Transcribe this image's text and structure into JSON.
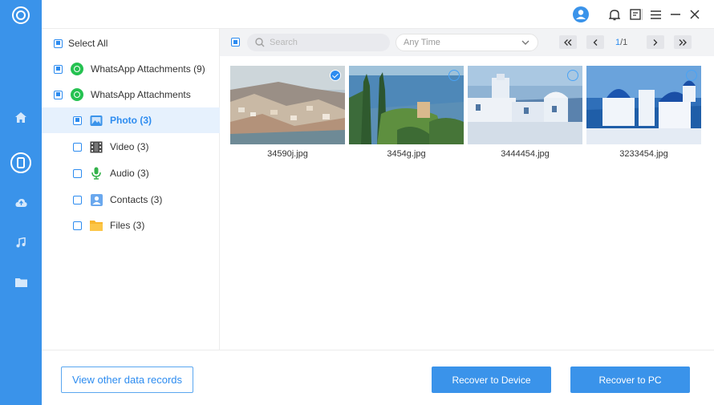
{
  "rail": {
    "items": [
      {
        "name": "home-icon"
      },
      {
        "name": "device-icon"
      },
      {
        "name": "cloud-icon"
      },
      {
        "name": "music-icon"
      },
      {
        "name": "folder-icon"
      }
    ],
    "accent": "#3a93ea"
  },
  "topbar": {
    "icons": [
      "account-icon",
      "bell-icon",
      "feedback-icon",
      "menu-icon",
      "minimize-icon",
      "close-icon"
    ]
  },
  "tree": {
    "select_all": "Select All",
    "items": [
      {
        "label": "WhatsApp Attachments (9)",
        "icon": "whatsapp-icon",
        "state": "partial"
      },
      {
        "label": "WhatsApp Attachments",
        "icon": "whatsapp-icon",
        "state": "partial"
      },
      {
        "label": "Photo (3)",
        "icon": "photo-icon",
        "state": "partial",
        "selected": true
      },
      {
        "label": "Video (3)",
        "icon": "video-icon",
        "state": "unchecked"
      },
      {
        "label": "Audio (3)",
        "icon": "microphone-icon",
        "state": "unchecked"
      },
      {
        "label": "Contacts (3)",
        "icon": "contact-icon",
        "state": "unchecked"
      },
      {
        "label": "Files (3)",
        "icon": "folder-icon",
        "state": "unchecked"
      }
    ]
  },
  "toolbar": {
    "search_placeholder": "Search",
    "time_filter": "Any Time",
    "page_current": "1",
    "page_total": "/1"
  },
  "photos": [
    {
      "name": "34590j.jpg",
      "checked": true
    },
    {
      "name": "3454g.jpg",
      "checked": false
    },
    {
      "name": "3444454.jpg",
      "checked": false
    },
    {
      "name": "3233454.jpg",
      "checked": false
    }
  ],
  "bottom": {
    "view_other": "View other data records",
    "recover_device": "Recover to Device",
    "recover_pc": "Recover to PC"
  }
}
